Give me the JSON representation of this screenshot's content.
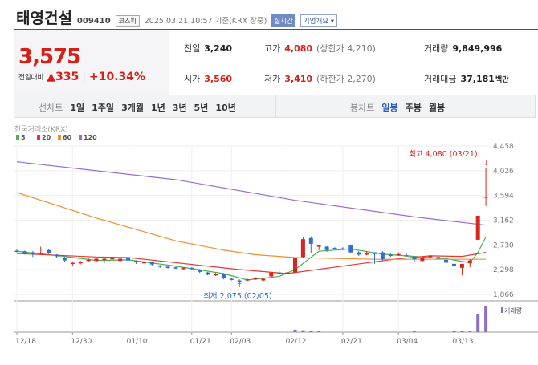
{
  "header": {
    "name": "태영건설",
    "code": "009410",
    "market": "코스피",
    "datetime": "2025.03.21 10:57 기준(KRX 장중)",
    "realtime": "실시간",
    "corp_info": "기업개요 ▾"
  },
  "quote": {
    "price": "3,575",
    "change_label": "전일대비",
    "change": "▲335",
    "change_pct": "+10.34%",
    "prev_label": "전일",
    "prev": "3,240",
    "high_label": "고가",
    "high": "4,080",
    "upper_limit": "(상한가 4,210)",
    "volume_label": "거래량",
    "volume": "9,849,996",
    "open_label": "시가",
    "open": "3,560",
    "low_label": "저가",
    "low": "3,410",
    "lower_limit": "(하한가 2,270)",
    "amount_label": "거래대금",
    "amount": "37,181",
    "amount_unit": "백만"
  },
  "tabs": {
    "line_label": "선차트",
    "line": [
      "1일",
      "1주일",
      "3개월",
      "1년",
      "3년",
      "5년",
      "10년"
    ],
    "candle_label": "봉차트",
    "candle": [
      "일봉",
      "주봉",
      "월봉"
    ],
    "candle_selected": "일봉"
  },
  "chart_data": {
    "type": "candlestick",
    "source": "한국거래소(KRX)",
    "legend": [
      {
        "name": "5",
        "color": "#4caf50"
      },
      {
        "name": "20",
        "color": "#e53935"
      },
      {
        "name": "60",
        "color": "#f09030"
      },
      {
        "name": "120",
        "color": "#9b6cd0"
      }
    ],
    "ylim": [
      1866,
      4458
    ],
    "yticks": [
      "4,458",
      "4,026",
      "3,594",
      "3,162",
      "2,730",
      "2,298",
      "1,866"
    ],
    "xticks": [
      [
        "12/18",
        0
      ],
      [
        "12/30",
        7
      ],
      [
        "01/10",
        14
      ],
      [
        "01/21",
        22
      ],
      [
        "02/03",
        27
      ],
      [
        "02/12",
        34
      ],
      [
        "02/21",
        41
      ],
      [
        "03/04",
        48
      ],
      [
        "03/13",
        55
      ]
    ],
    "high_note": "최고 4,080 (03/21)",
    "low_note": "최저 2,075 (02/05)",
    "high_idx": 59,
    "low_idx": 28,
    "volume_label": "거래량",
    "ohlc": [
      [
        2630,
        2660,
        2600,
        2620
      ],
      [
        2620,
        2630,
        2560,
        2580
      ],
      [
        2600,
        2620,
        2520,
        2570
      ],
      [
        2580,
        2700,
        2560,
        2590
      ],
      [
        2640,
        2660,
        2570,
        2580
      ],
      [
        2560,
        2570,
        2510,
        2530
      ],
      [
        2510,
        2520,
        2440,
        2460
      ],
      [
        2400,
        2440,
        2360,
        2420
      ],
      [
        2410,
        2450,
        2390,
        2430
      ],
      [
        2450,
        2500,
        2440,
        2470
      ],
      [
        2450,
        2500,
        2440,
        2490
      ],
      [
        2480,
        2510,
        2410,
        2490
      ],
      [
        2490,
        2510,
        2480,
        2500
      ],
      [
        2450,
        2500,
        2440,
        2490
      ],
      [
        2500,
        2510,
        2450,
        2460
      ],
      [
        2450,
        2460,
        2400,
        2440
      ],
      [
        2420,
        2440,
        2410,
        2430
      ],
      [
        2430,
        2440,
        2370,
        2390
      ],
      [
        2370,
        2380,
        2330,
        2350
      ],
      [
        2350,
        2360,
        2320,
        2330
      ],
      [
        2340,
        2350,
        2310,
        2320
      ],
      [
        2320,
        2340,
        2300,
        2330
      ],
      [
        2330,
        2340,
        2290,
        2310
      ],
      [
        2300,
        2310,
        2240,
        2260
      ],
      [
        2250,
        2260,
        2200,
        2210
      ],
      [
        2200,
        2240,
        2190,
        2220
      ],
      [
        2230,
        2240,
        2130,
        2150
      ],
      [
        2140,
        2150,
        2110,
        2120
      ],
      [
        2110,
        2130,
        2075,
        2100
      ],
      [
        2110,
        2140,
        2100,
        2130
      ],
      [
        2130,
        2170,
        2120,
        2150
      ],
      [
        2110,
        2160,
        2080,
        2140
      ],
      [
        2180,
        2260,
        2170,
        2250
      ],
      [
        2250,
        2280,
        2210,
        2230
      ],
      [
        2240,
        2260,
        2230,
        2250
      ],
      [
        2250,
        2930,
        2250,
        2500
      ],
      [
        2520,
        2870,
        2510,
        2830
      ],
      [
        2850,
        2880,
        2590,
        2750
      ],
      [
        2700,
        2730,
        2640,
        2720
      ],
      [
        2700,
        2710,
        2610,
        2640
      ],
      [
        2680,
        2690,
        2660,
        2670
      ],
      [
        2670,
        2690,
        2640,
        2660
      ],
      [
        2720,
        2730,
        2580,
        2600
      ],
      [
        2600,
        2620,
        2540,
        2560
      ],
      [
        2570,
        2620,
        2550,
        2580
      ],
      [
        2600,
        2600,
        2400,
        2570
      ],
      [
        2600,
        2620,
        2460,
        2480
      ],
      [
        2560,
        2580,
        2520,
        2550
      ],
      [
        2560,
        2600,
        2540,
        2570
      ],
      [
        2550,
        2580,
        2530,
        2540
      ],
      [
        2520,
        2540,
        2440,
        2480
      ],
      [
        2450,
        2520,
        2440,
        2510
      ],
      [
        2530,
        2560,
        2510,
        2540
      ],
      [
        2520,
        2540,
        2480,
        2490
      ],
      [
        2470,
        2480,
        2410,
        2420
      ],
      [
        2400,
        2410,
        2300,
        2360
      ],
      [
        2330,
        2400,
        2200,
        2400
      ],
      [
        2410,
        2480,
        2340,
        2460
      ],
      [
        2820,
        3240,
        2820,
        3240
      ],
      [
        3560,
        4080,
        3410,
        3575
      ]
    ],
    "ma": {
      "5": [
        [
          0,
          2620
        ],
        [
          6,
          2530
        ],
        [
          10,
          2460
        ],
        [
          14,
          2470
        ],
        [
          20,
          2360
        ],
        [
          26,
          2230
        ],
        [
          29,
          2120
        ],
        [
          33,
          2180
        ],
        [
          35,
          2300
        ],
        [
          38,
          2620
        ],
        [
          42,
          2660
        ],
        [
          46,
          2570
        ],
        [
          50,
          2530
        ],
        [
          54,
          2490
        ],
        [
          57,
          2420
        ],
        [
          58,
          2600
        ],
        [
          59,
          2870
        ]
      ],
      "20": [
        [
          0,
          2580
        ],
        [
          10,
          2520
        ],
        [
          14,
          2510
        ],
        [
          20,
          2420
        ],
        [
          28,
          2300
        ],
        [
          34,
          2230
        ],
        [
          42,
          2380
        ],
        [
          48,
          2490
        ],
        [
          52,
          2540
        ],
        [
          56,
          2530
        ],
        [
          59,
          2600
        ]
      ],
      "60": [
        [
          0,
          3645
        ],
        [
          10,
          3200
        ],
        [
          20,
          2800
        ],
        [
          26,
          2640
        ],
        [
          30,
          2560
        ],
        [
          35,
          2510
        ],
        [
          45,
          2480
        ],
        [
          59,
          2480
        ]
      ],
      "120": [
        [
          0,
          4182
        ],
        [
          20,
          3870
        ],
        [
          35,
          3510
        ],
        [
          50,
          3220
        ],
        [
          59,
          3075
        ]
      ]
    },
    "volume": [
      [
        35,
        2
      ],
      [
        36,
        1.5
      ],
      [
        37,
        0.8
      ],
      [
        38,
        0.7
      ],
      [
        50,
        0.6
      ],
      [
        55,
        0.8
      ],
      [
        56,
        0.8
      ],
      [
        57,
        1.2
      ],
      [
        58,
        14
      ],
      [
        59,
        21
      ]
    ],
    "volume_max": 21
  }
}
